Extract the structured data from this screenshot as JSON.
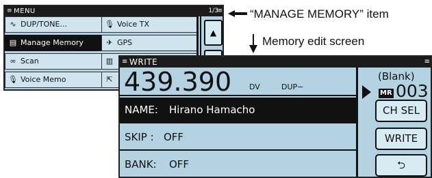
{
  "menu": {
    "title": "MENU",
    "page": "1/3",
    "items_left": [
      {
        "icon": "tone-icon",
        "glyph": "∿",
        "label": "DUP/TONE..."
      },
      {
        "icon": "memory-icon",
        "glyph": "▤",
        "label": "Manage Memory",
        "selected": true
      },
      {
        "icon": "binoculars-icon",
        "glyph": "∞",
        "label": "Scan"
      },
      {
        "icon": "mic-icon",
        "glyph": "🎙",
        "label": "Voice Memo"
      }
    ],
    "items_right": [
      {
        "icon": "voice-tx-icon",
        "glyph": "🎙",
        "label": "Voice TX"
      },
      {
        "icon": "gps-icon",
        "glyph": "✈",
        "label": "GPS"
      },
      {
        "icon": "cs-icon",
        "glyph": "▥",
        "label": ""
      },
      {
        "icon": "exit-icon",
        "glyph": "⇱",
        "label": ""
      }
    ],
    "scroll_up_glyph": "▲"
  },
  "annotations": {
    "manage_memory": "“MANAGE MEMORY” item",
    "memory_edit": "Memory edit screen"
  },
  "write": {
    "title": "WRITE",
    "frequency": "439.390",
    "mode": "DV",
    "dup": "DUP−",
    "blank": "(Blank)",
    "mr_badge": "MR",
    "memory_number": "003",
    "fields": [
      {
        "key": "NAME:",
        "value": "Hirano Hamacho",
        "selected": true
      },
      {
        "key": "SKIP  :",
        "value": "OFF"
      },
      {
        "key": "BANK:",
        "value": "OFF"
      }
    ],
    "buttons": {
      "ch_sel": "CH SEL",
      "write": "WRITE",
      "back": "⮌"
    }
  }
}
